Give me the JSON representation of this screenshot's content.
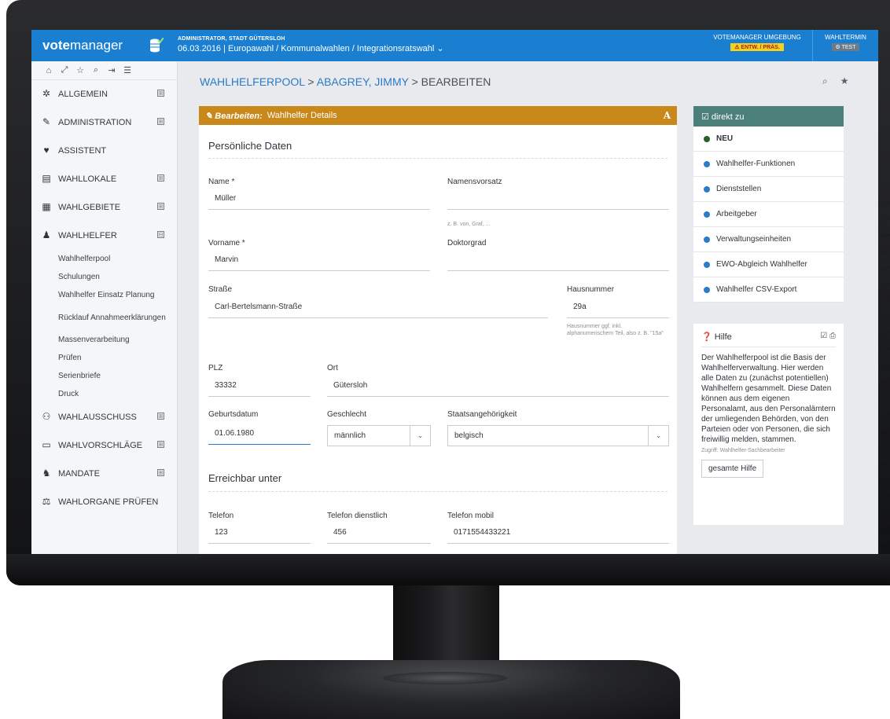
{
  "app": {
    "logo_bold": "vote",
    "logo_rest": "manager"
  },
  "topbar": {
    "admin": "ADMINISTRATOR, STADT GÜTERSLOH",
    "context": "06.03.2016 | Europawahl / Kommunalwahlen / Integrationsratswahl ⌄",
    "env_label": "VOTEMANAGER UMGEBUNG",
    "env_badge": "⚠ ENTW. / PRÄS.",
    "termin_label": "WAHLTERMIN",
    "termin_badge": "⚙ TEST"
  },
  "sidebar": {
    "tools": [
      "⌂",
      "⤢",
      "☆",
      "⌕",
      "⇥",
      "☰"
    ],
    "items": [
      {
        "label": "ALLGEMEIN",
        "icon": "✲",
        "expand": "⊞"
      },
      {
        "label": "ADMINISTRATION",
        "icon": "✎",
        "expand": "⊞"
      },
      {
        "label": "ASSISTENT",
        "icon": "♥",
        "expand": ""
      },
      {
        "label": "WAHLLOKALE",
        "icon": "▤",
        "expand": "⊞"
      },
      {
        "label": "WAHLGEBIETE",
        "icon": "▦",
        "expand": "⊞"
      },
      {
        "label": "WAHLHELFER",
        "icon": "♟",
        "expand": "⊟"
      }
    ],
    "sub": [
      "Wahlhelferpool",
      "Schulungen",
      "Wahlhelfer Einsatz Planung",
      "Rücklauf Annahmeerklärungen",
      "Massenverarbeitung",
      "Prüfen",
      "Serienbriefe",
      "Druck"
    ],
    "items2": [
      {
        "label": "WAHLAUSSCHUSS",
        "icon": "⚇",
        "expand": "⊞"
      },
      {
        "label": "WAHLVORSCHLÄGE",
        "icon": "▭",
        "expand": "⊞"
      },
      {
        "label": "MANDATE",
        "icon": "♞",
        "expand": "⊞"
      },
      {
        "label": "WAHLORGANE PRÜFEN",
        "icon": "⚖",
        "expand": ""
      }
    ]
  },
  "breadcrumb": {
    "part1": "WAHLHELFERPOOL",
    "sep1": " > ",
    "part2": "ABAGREY, JIMMY",
    "sep2": " > ",
    "part3": "BEARBEITEN"
  },
  "panel": {
    "head_bold": "✎ Bearbeiten:",
    "head_rest": "Wahlhelfer Details",
    "head_a": "A",
    "section1": "Persönliche Daten",
    "section2": "Erreichbar unter",
    "fields": {
      "name_label": "Name *",
      "name_value": "Müller",
      "namensvorsatz_label": "Namensvorsatz",
      "namensvorsatz_hint": "z. B. von, Graf, ...",
      "vorname_label": "Vorname *",
      "vorname_value": "Marvin",
      "doktorgrad_label": "Doktorgrad",
      "strasse_label": "Straße",
      "strasse_value": "Carl-Bertelsmann-Straße",
      "hausnummer_label": "Hausnummer",
      "hausnummer_value": "29a",
      "hausnummer_hint": "Hausnummer ggf. inkl. alphanumerischem Teil, also z. B. \"15a\"",
      "plz_label": "PLZ",
      "plz_value": "33332",
      "ort_label": "Ort",
      "ort_value": "Gütersloh",
      "geburtsdatum_label": "Geburtsdatum",
      "geburtsdatum_value": "01.06.1980",
      "geschlecht_label": "Geschlecht",
      "geschlecht_value": "männlich",
      "staat_label": "Staatsangehörigkeit",
      "staat_value": "belgisch",
      "telefon_label": "Telefon",
      "telefon_value": "123",
      "telefon_dienst_label": "Telefon dienstlich",
      "telefon_dienst_value": "456",
      "telefon_mobil_label": "Telefon mobil",
      "telefon_mobil_value": "0171554433221"
    }
  },
  "direkt": {
    "title": "☑ direkt zu",
    "links": [
      "NEU",
      "Wahlhelfer-Funktionen",
      "Dienststellen",
      "Arbeitgeber",
      "Verwaltungseinheiten",
      "EWO-Abgleich Wahlhelfer",
      "Wahlhelfer CSV-Export"
    ]
  },
  "hilfe": {
    "title": "❓ Hilfe",
    "icons": "☑ ⎙",
    "text": "Der Wahlhelferpool ist die Basis der Wahlhelferverwaltung. Hier werden alle Daten zu (zunächst potentiellen) Wahlhelfern gesammelt. Diese Daten können aus dem eigenen Personalamt, aus den Personalämtern der umliegenden Behörden, von den Parteien oder von Personen, die sich freiwillig melden, stammen.",
    "access": "Zugriff: Wahlhelfer-Sachbearbeiter",
    "button": "gesamte Hilfe"
  }
}
